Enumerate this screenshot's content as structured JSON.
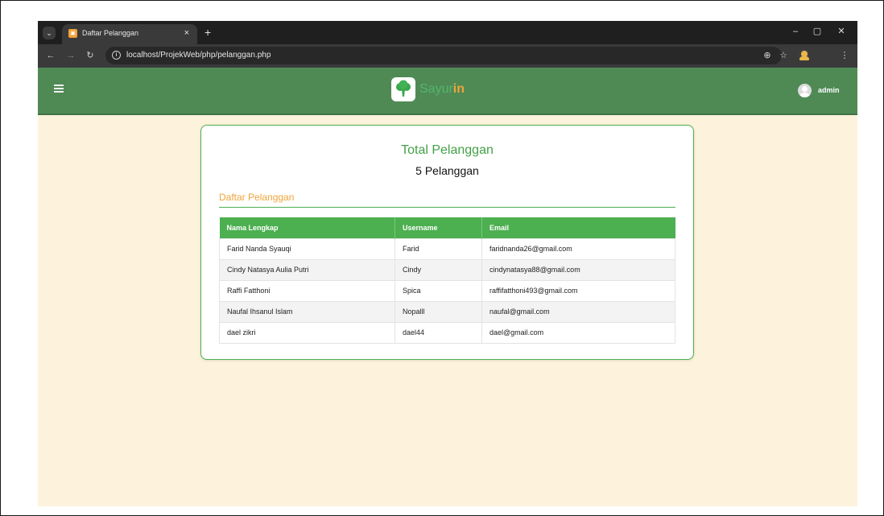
{
  "browser": {
    "tab_title": "Daftar Pelanggan",
    "tab_close": "×",
    "new_tab": "+",
    "url": "localhost/ProjekWeb/php/pelanggan.php",
    "icons": [
      "tab-search-icon",
      "favicon-icon",
      "close-icon",
      "plus-icon",
      "minimize-icon",
      "restore-icon",
      "back-icon",
      "forward-icon",
      "reload-icon",
      "info-icon",
      "zoom-icon",
      "star-icon",
      "profile-icon",
      "kebab-menu-icon"
    ]
  },
  "header": {
    "brand_prefix": "Sayur",
    "brand_suffix": "in",
    "user": "admin",
    "colors": {
      "bar": "#4f8a55",
      "brand_prefix": "#53b56b",
      "brand_suffix": "#f0a43a"
    }
  },
  "card": {
    "title": "Total Pelanggan",
    "count": "5 Pelanggan",
    "section_title": "Daftar Pelanggan",
    "colors": {
      "accent": "#4caf50",
      "section": "#f0a43a"
    }
  },
  "table": {
    "headers": [
      "Nama Lengkap",
      "Username",
      "Email"
    ],
    "rows": [
      [
        "Farid Nanda Syauqi",
        "Farid",
        "faridnanda26@gmail.com"
      ],
      [
        "Cindy Natasya Aulia Putri",
        "Cindy",
        "cindynatasya88@gmail.com"
      ],
      [
        "Raffi Fatthoni",
        "Spica",
        "raffifatthoni493@gmail.com"
      ],
      [
        "Naufal Ihsanul Islam",
        "Nopalll",
        "naufal@gmail.com"
      ],
      [
        "dael zikri",
        "dael44",
        "dael@gmail.com"
      ]
    ]
  },
  "page_background": "#fdf3dc"
}
